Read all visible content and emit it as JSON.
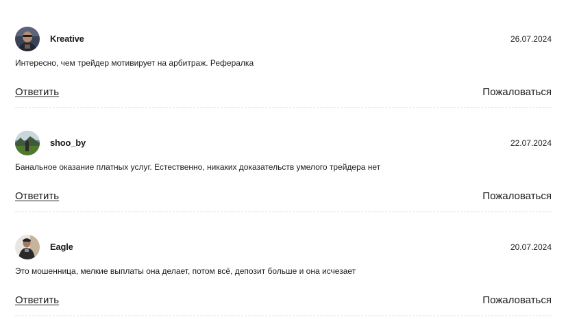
{
  "comments": [
    {
      "author": "Kreative",
      "date": "26.07.2024",
      "text": "Интересно, чем трейдер мотивирует на арбитраж. Рефералка",
      "reply_label": "Ответить",
      "report_label": "Пожаловаться",
      "avatar_icon": "user-photo"
    },
    {
      "author": "shoo_by",
      "date": "22.07.2024",
      "text": "Банальное оказание платных услуг. Естественно, никаких доказательств умелого трейдера нет",
      "reply_label": "Ответить",
      "report_label": "Пожаловаться",
      "avatar_icon": "landscape-photo"
    },
    {
      "author": "Eagle",
      "date": "20.07.2024",
      "text": "Это мошенница, мелкие выплаты она делает, потом всё, депозит больше и она исчезает",
      "reply_label": "Ответить",
      "report_label": "Пожаловаться",
      "avatar_icon": "user-photo"
    }
  ]
}
